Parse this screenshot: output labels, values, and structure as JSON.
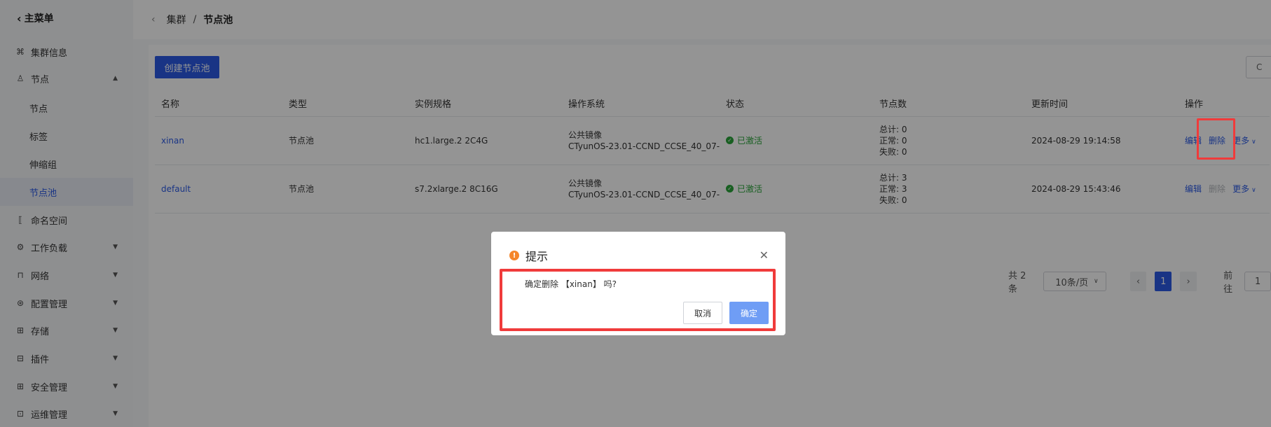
{
  "sidebar": {
    "back_label": "主菜单",
    "items": [
      {
        "label": "集群信息",
        "icon": "cluster-icon",
        "expandable": false
      },
      {
        "label": "节点",
        "icon": "node-icon",
        "expandable": true,
        "expanded": true,
        "children": [
          {
            "label": "节点",
            "active": false
          },
          {
            "label": "标签",
            "active": false
          },
          {
            "label": "伸缩组",
            "active": false
          },
          {
            "label": "节点池",
            "active": true
          }
        ]
      },
      {
        "label": "命名空间",
        "icon": "namespace-icon",
        "expandable": false
      },
      {
        "label": "工作负载",
        "icon": "workload-icon",
        "expandable": true
      },
      {
        "label": "网络",
        "icon": "network-icon",
        "expandable": true
      },
      {
        "label": "配置管理",
        "icon": "config-icon",
        "expandable": true
      },
      {
        "label": "存储",
        "icon": "storage-icon",
        "expandable": true
      },
      {
        "label": "插件",
        "icon": "plugin-icon",
        "expandable": true
      },
      {
        "label": "安全管理",
        "icon": "security-icon",
        "expandable": true
      },
      {
        "label": "运维管理",
        "icon": "ops-icon",
        "expandable": true
      }
    ]
  },
  "breadcrumb": {
    "parent": "集群",
    "separator": "/",
    "current": "节点池"
  },
  "toolbar": {
    "create_label": "创建节点池",
    "refresh_glyph": "C"
  },
  "table": {
    "headers": [
      "名称",
      "类型",
      "实例规格",
      "操作系统",
      "状态",
      "节点数",
      "更新时间",
      "操作"
    ],
    "rows": [
      {
        "name": "xinan",
        "type": "节点池",
        "spec": "hc1.large.2 2C4G",
        "os_line1": "公共镜像",
        "os_line2": "CTyunOS-23.01-CCND_CCSE_40_07-",
        "status": "已激活",
        "count_total": "总计: 0",
        "count_normal": "正常: 0",
        "count_failed": "失败: 0",
        "updated": "2024-08-29 19:14:58",
        "op_edit": "编辑",
        "op_delete": "删除",
        "op_more": "更多",
        "delete_enabled": true
      },
      {
        "name": "default",
        "type": "节点池",
        "spec": "s7.2xlarge.2 8C16G",
        "os_line1": "公共镜像",
        "os_line2": "CTyunOS-23.01-CCND_CCSE_40_07-",
        "status": "已激活",
        "count_total": "总计: 3",
        "count_normal": "正常: 3",
        "count_failed": "失败: 0",
        "updated": "2024-08-29 15:43:46",
        "op_edit": "编辑",
        "op_delete": "删除",
        "op_more": "更多",
        "delete_enabled": false
      }
    ]
  },
  "pagination": {
    "total_label": "共 2 条",
    "page_size": "10条/页",
    "current_page": "1",
    "jump_label": "前往",
    "jump_value": "1"
  },
  "dialog": {
    "title": "提示",
    "message": "确定删除 【xinan】 吗?",
    "cancel_label": "取消",
    "confirm_label": "确定"
  },
  "colors": {
    "primary": "#2c5be5",
    "success": "#2aa43a",
    "warning": "#f5862a",
    "highlight": "#f03b3b"
  }
}
